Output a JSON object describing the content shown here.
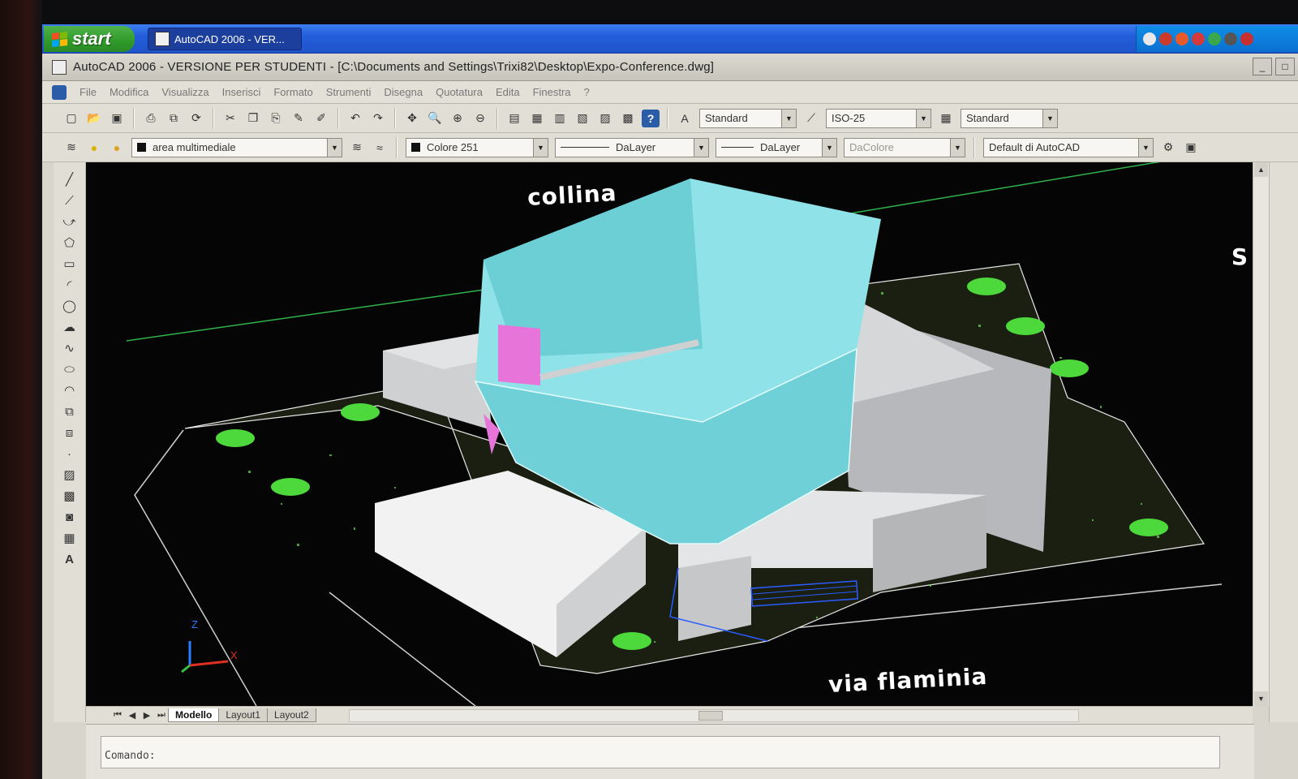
{
  "taskbar": {
    "start_label": "start",
    "task_item": "AutoCAD 2006 - VER..."
  },
  "window": {
    "title": "AutoCAD 2006 - VERSIONE PER STUDENTI - [C:\\Documents and Settings\\Trixi82\\Desktop\\Expo-Conference.dwg]"
  },
  "menu": [
    "File",
    "Modifica",
    "Visualizza",
    "Inserisci",
    "Formato",
    "Strumenti",
    "Disegna",
    "Quotatura",
    "Edita",
    "Finestra",
    "?"
  ],
  "toolbar1": {
    "text_style": "Standard",
    "dim_style": "ISO-25",
    "table_style": "Standard"
  },
  "toolbar2": {
    "layer": "area multimediale",
    "color": "Colore 251",
    "linetype": "DaLayer",
    "lineweight": "DaLayer",
    "plotstyle": "DaColore",
    "workspace": "Default di AutoCAD"
  },
  "drawing": {
    "label_top": "collina",
    "label_bottom": "via flaminia",
    "label_right": "S",
    "ucs_z": "Z",
    "ucs_x": "X"
  },
  "layout_tabs": [
    "Modello",
    "Layout1",
    "Layout2"
  ],
  "command": {
    "prompt": "Comando:"
  },
  "colors": {
    "viewport_bg": "#050505",
    "cyan_body": "#7fd9df",
    "grey_mass": "#c7c9cc",
    "ground_green": "#4dd93b",
    "taskbar_blue": "#245edb"
  }
}
